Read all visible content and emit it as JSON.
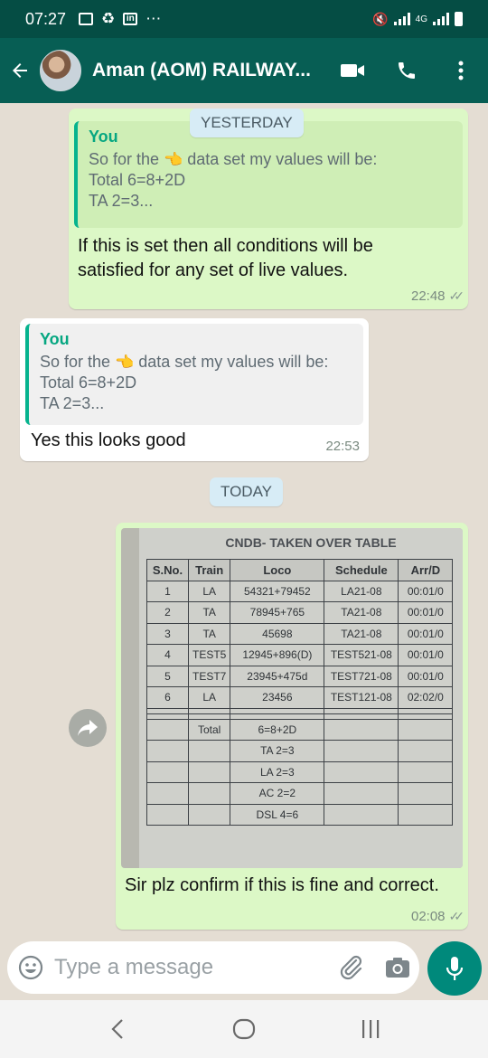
{
  "status_bar": {
    "time": "07:27",
    "network": "4G"
  },
  "header": {
    "contact_name": "Aman (AOM) RAILWAY..."
  },
  "day_labels": {
    "yesterday": "YESTERDAY",
    "today": "TODAY"
  },
  "messages": [
    {
      "direction": "outgoing",
      "quote": {
        "author": "You",
        "line1_a": "So for the",
        "line1_b": "data set my values will be:",
        "line2": "Total 6=8+2D",
        "line3": "TA 2=3..."
      },
      "text": "If this is set then all conditions will be satisfied for any set of live values.",
      "time": "22:48",
      "status": "read"
    },
    {
      "direction": "incoming",
      "quote": {
        "author": "You",
        "line1_a": "So for the",
        "line1_b": "data set my values will be:",
        "line2": "Total 6=8+2D",
        "line3": "TA 2=3..."
      },
      "text": "Yes this looks good",
      "time": "22:53"
    },
    {
      "direction": "outgoing",
      "image": {
        "title": "CNDB- TAKEN OVER TABLE",
        "columns": [
          "S.No.",
          "Train",
          "Loco",
          "Schedule",
          "Arr/D"
        ],
        "rows": [
          [
            "1",
            "LA",
            "54321+79452",
            "LA21-08",
            "00:01/0"
          ],
          [
            "2",
            "TA",
            "78945+765",
            "TA21-08",
            "00:01/0"
          ],
          [
            "3",
            "TA",
            "45698",
            "TA21-08",
            "00:01/0"
          ],
          [
            "4",
            "TEST5",
            "12945+896(D)",
            "TEST521-08",
            "00:01/0"
          ],
          [
            "5",
            "TEST7",
            "23945+475d",
            "TEST721-08",
            "00:01/0"
          ],
          [
            "6",
            "LA",
            "23456",
            "TEST121-08",
            "02:02/0"
          ]
        ],
        "summary": [
          [
            "",
            "Total",
            "6=8+2D",
            "",
            ""
          ],
          [
            "",
            "",
            "TA 2=3",
            "",
            ""
          ],
          [
            "",
            "",
            "LA 2=3",
            "",
            ""
          ],
          [
            "",
            "",
            "AC 2=2",
            "",
            ""
          ],
          [
            "",
            "",
            "DSL 4=6",
            "",
            ""
          ]
        ]
      },
      "text": "Sir plz confirm if this is fine and correct.",
      "time": "02:08",
      "status": "read"
    }
  ],
  "composer": {
    "placeholder": "Type a message"
  },
  "colors": {
    "header": "#075e54",
    "status_bar": "#054d44",
    "outgoing": "#dcf8c6",
    "incoming": "#ffffff",
    "accent": "#00897b"
  },
  "icons": [
    "back-arrow-icon",
    "video-call-icon",
    "phone-icon",
    "more-options-icon",
    "emoji-icon",
    "attach-icon",
    "camera-icon",
    "mic-icon",
    "forward-icon",
    "nav-back-icon",
    "nav-home-icon",
    "nav-recents-icon"
  ]
}
